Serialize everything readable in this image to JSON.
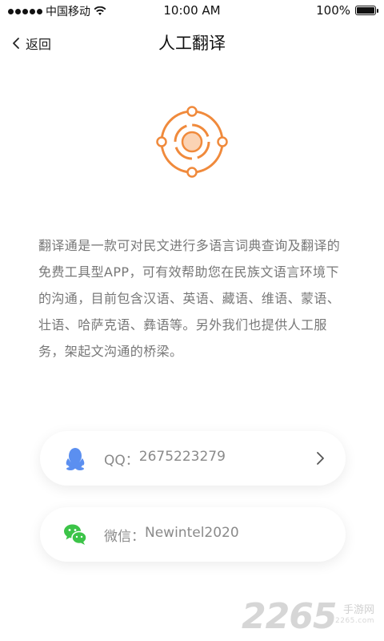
{
  "status_bar": {
    "carrier": "中国移动",
    "time": "10:00 AM",
    "battery": "100%",
    "battery_level": 1.0
  },
  "nav": {
    "back_label": "返回",
    "title": "人工翻译"
  },
  "logo": {
    "icon": "translation-target-icon",
    "color": "#f08a3c"
  },
  "intro": {
    "text": "翻译通是一款可对民文进行多语言词典查询及翻译的免费工具型APP，可有效帮助您在民族文语言环境下的沟通，目前包含汉语、英语、藏语、维语、蒙语、壮语、哈萨克语、彝语等。另外我们也提供人工服务，架起文沟通的桥梁。"
  },
  "contacts": {
    "qq": {
      "label": "QQ：",
      "value": "2675223279",
      "icon": "qq-icon",
      "color": "#5b8ff0"
    },
    "wechat": {
      "label": "微信：",
      "value": "Newintel2020",
      "icon": "wechat-icon",
      "color": "#3cc448"
    }
  },
  "watermark": {
    "number": "2265",
    "suffix": "手游网",
    "url": "2265.com"
  }
}
